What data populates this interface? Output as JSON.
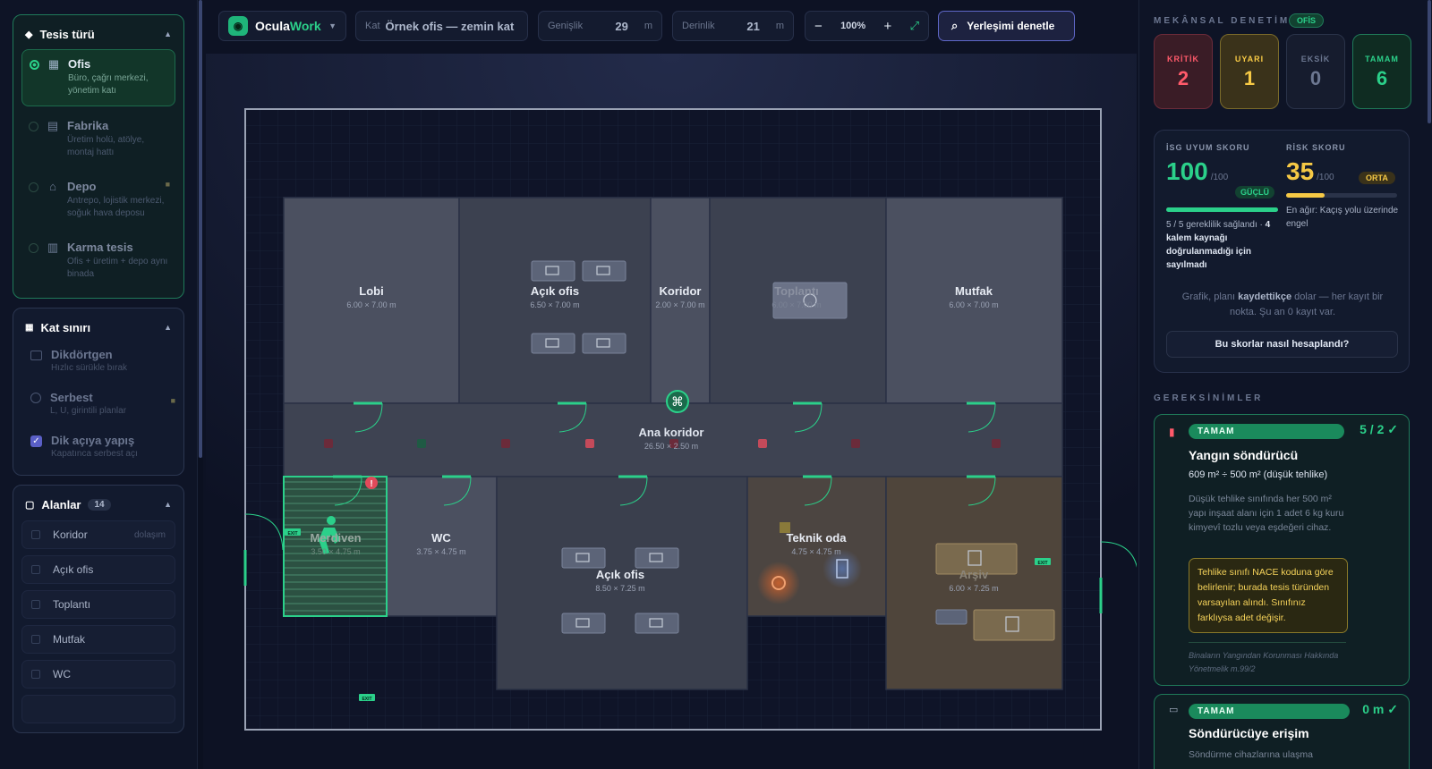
{
  "left": {
    "facility": {
      "title": "Tesis türü",
      "items": [
        {
          "icon": "building-icon",
          "label": "Ofis",
          "desc": "Büro, çağrı merkezi, yönetim katı",
          "selected": true,
          "locked": false
        },
        {
          "icon": "factory-icon",
          "label": "Fabrika",
          "desc": "Üretim holü, atölye, montaj hattı",
          "selected": false,
          "locked": false
        },
        {
          "icon": "warehouse-icon",
          "label": "Depo",
          "desc": "Antrepo, lojistik merkezi, soğuk hava deposu",
          "selected": false,
          "locked": true
        },
        {
          "icon": "mixed-icon",
          "label": "Karma tesis",
          "desc": "Ofis + üretim + depo aynı binada",
          "selected": false,
          "locked": false
        }
      ]
    },
    "boundary": {
      "title": "Kat sınırı",
      "items": [
        {
          "label": "Dikdörtgen",
          "desc": "Hızlıc sürükle bırak"
        },
        {
          "label": "Serbest",
          "desc": "L, U, girintili planlar"
        },
        {
          "label": "Dik açıya yapış",
          "desc": "Kapatınca serbest açı"
        }
      ]
    },
    "areas": {
      "title": "Alanlar",
      "count": "14",
      "items": [
        {
          "label": "Koridor",
          "tag": "dolaşım"
        },
        {
          "label": "Açık ofis",
          "tag": ""
        },
        {
          "label": "Toplantı",
          "tag": ""
        },
        {
          "label": "Mutfak",
          "tag": ""
        },
        {
          "label": "WC",
          "tag": ""
        }
      ]
    }
  },
  "topbar": {
    "logo_a": "Ocula",
    "logo_b": "Work",
    "kat_label": "Kat",
    "kat_value": "Örnek ofis — zemin kat",
    "width_label": "Genişlik",
    "width_value": "29",
    "depth_label": "Derinlik",
    "depth_value": "21",
    "unit": "m",
    "zoom": "100%",
    "minus": "−",
    "plus": "+",
    "check_label": "Yerleşimi denetle"
  },
  "plan": {
    "rooms": [
      {
        "name": "Lobi",
        "dim": "6.00 × 7.00 m"
      },
      {
        "name": "Açık ofis",
        "dim": "6.50 × 7.00 m"
      },
      {
        "name": "Koridor",
        "dim": "2.00 × 7.00 m"
      },
      {
        "name": "Toplantı",
        "dim": "6.00 × 7.00 m"
      },
      {
        "name": "Mutfak",
        "dim": "6.00 × 7.00 m"
      },
      {
        "name": "Ana koridor",
        "dim": "26.50 × 2.50 m"
      },
      {
        "name": "Merdiven",
        "dim": "3.50 × 4.75 m"
      },
      {
        "name": "WC",
        "dim": "3.75 × 4.75 m"
      },
      {
        "name": "Açık ofis",
        "dim": "8.50 × 7.25 m"
      },
      {
        "name": "Teknik oda",
        "dim": "4.75 × 4.75 m"
      },
      {
        "name": "Arşiv",
        "dim": "6.00 × 7.25 m"
      }
    ],
    "exit_label": "EXIT"
  },
  "right": {
    "audit_title": "MEKÂNSAL DENETİM",
    "audit_tag": "OFİS",
    "cards": [
      {
        "label": "KRİTİK",
        "value": "2",
        "color": "#ff5a6a"
      },
      {
        "label": "UYARI",
        "value": "1",
        "color": "#f6c945"
      },
      {
        "label": "EKSİK",
        "value": "0",
        "color": "#6c7791"
      },
      {
        "label": "TAMAM",
        "value": "6",
        "color": "#2bd08a"
      }
    ],
    "isg": {
      "title": "İSG UYUM SKORU",
      "value": "100",
      "max": "/100",
      "grade": "GÜÇLÜ",
      "fill": 1.0,
      "note_a": "5 / 5 gereklilik sağlandı · ",
      "note_b": "4 kalem kaynağı doğrulanmadığı için sayılmadı"
    },
    "risk": {
      "title": "RİSK SKORU",
      "value": "35",
      "max": "/100",
      "grade": "ORTA",
      "fill": 0.35,
      "note": "En ağır: Kaçış yolu üzerinde engel"
    },
    "history_a": "Grafik, planı ",
    "history_b": "kaydettikçe",
    "history_c": " dolar — her kayıt bir nokta. Şu an 0 kayıt var.",
    "how_btn": "Bu skorlar nasıl hesaplandı?",
    "req_title": "GEREKSİNİMLER",
    "req1": {
      "status": "TAMAM",
      "ratio": "5 / 2 ✓",
      "title": "Yangın söndürücü",
      "sub": "609 m² ÷ 500 m² (düşük tehlike)",
      "desc": "Düşük tehlike sınıfında her 500 m² yapı inşaat alanı için 1 adet 6 kg kuru kimyevî tozlu veya eşdeğeri cihaz.",
      "warn": "Tehlike sınıfı NACE koduna göre belirlenir; burada tesis türünden varsayılan alındı. Sınıfınız farklıysa adet değişir.",
      "ref": "Binaların Yangından Korunması Hakkında Yönetmelik m.99/2"
    },
    "req2": {
      "status": "TAMAM",
      "ratio": "0 m ✓",
      "title": "Söndürücüye erişim",
      "desc": "Söndürme cihazlarına ulaşma"
    }
  }
}
